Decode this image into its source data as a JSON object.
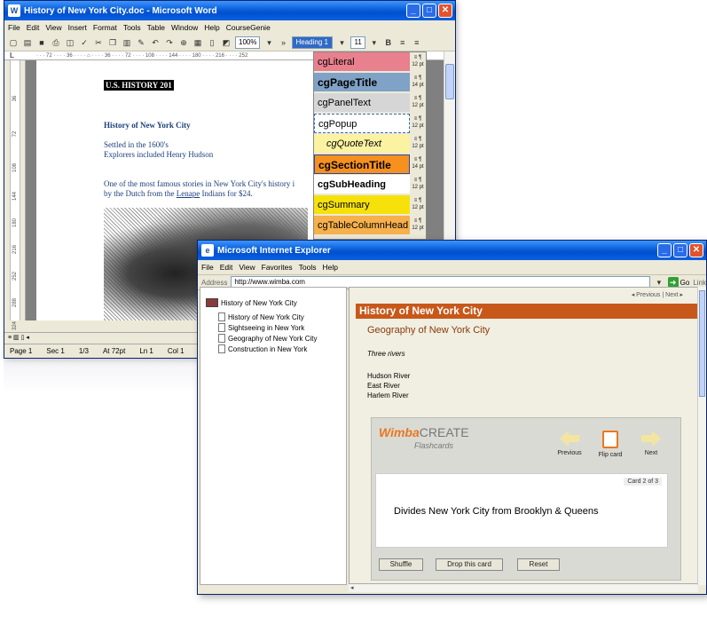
{
  "word": {
    "title": "History of New York City.doc - Microsoft Word",
    "menu": [
      "File",
      "Edit",
      "View",
      "Insert",
      "Format",
      "Tools",
      "Table",
      "Window",
      "Help",
      "CourseGenie"
    ],
    "toolbar": {
      "zoom": "100%",
      "style": "Heading 1",
      "font_size": "11"
    },
    "ruler": "· · · 72 · · · · 36 · · · · ⌂ · · · · 36 · · · · 72 · · · · 108 · · · · 144 · · · · 180 · · · · 216 · · · · 252",
    "vruler_labels": [
      "36",
      "72",
      "108",
      "144",
      "180",
      "216",
      "252",
      "288",
      "324"
    ],
    "document": {
      "heading": "U.S. HISTORY 201",
      "title": "History of New York City",
      "line1": "Settled in the 1600's",
      "line2": "Explorers included Henry Hudson",
      "para_a": "One of the most famous stories in New York City's history i",
      "para_b_prefix": "by the Dutch from the ",
      "para_b_link": "Lenape",
      "para_b_suffix": " Indians for $24."
    },
    "status": {
      "page": "Page 1",
      "sec": "Sec 1",
      "count": "1/3",
      "at": "At 72pt",
      "ln": "Ln 1",
      "col": "Col 1"
    },
    "styles": [
      {
        "name": "cgLiteral",
        "bg": "#e8808e",
        "size": "12 pt"
      },
      {
        "name": "cgPageTitle",
        "bg": "#7fa2c6",
        "size": "14 pt"
      },
      {
        "name": "cgPanelText",
        "bg": "#d6d6d6",
        "size": "12 pt"
      },
      {
        "name": "cgPopup",
        "bg": "#ffffff",
        "size": "12 pt"
      },
      {
        "name": "cgQuoteText",
        "bg": "#fbf2a2",
        "size": "12 pt"
      },
      {
        "name": "cgSectionTitle",
        "bg": "#f6901e",
        "size": "14 pt"
      },
      {
        "name": "cgSubHeading",
        "bg": "#ffffff",
        "size": "12 pt"
      },
      {
        "name": "cgSummary",
        "bg": "#f6e20a",
        "size": "12 pt"
      },
      {
        "name": "cgTableColumnHead",
        "bg": "#f6b04c",
        "size": "12 pt"
      }
    ]
  },
  "ie": {
    "title": "Microsoft Internet Explorer",
    "menu": [
      "File",
      "Edit",
      "View",
      "Favorites",
      "Tools",
      "Help"
    ],
    "address_label": "Address",
    "url": "http://www.wimba.com",
    "go": "Go",
    "links": "Link",
    "toc": {
      "root": "History of New York City",
      "items": [
        "History of New York City",
        "Sightseeing in New York",
        "Geography of New York City",
        "Construction in New York"
      ]
    },
    "nav": {
      "previous": "◂ Previous",
      "sep": " | ",
      "next": "Next ▸"
    },
    "topic": "History of New York City",
    "subtitle": "Geography of New York City",
    "three": "Three rivers",
    "rivers": [
      "Hudson River",
      "East River",
      "Harlem River"
    ],
    "flashcards": {
      "brand": "Wimba",
      "brand2": "CREATE",
      "sub": "Flashcards",
      "previous": "Previous",
      "flip": "Flip card",
      "next": "Next",
      "card_num": "Card 2 of 3",
      "card_text": "Divides New York City from Brooklyn & Queens",
      "shuffle": "Shuffle",
      "drop": "Drop this card",
      "reset": "Reset"
    }
  }
}
